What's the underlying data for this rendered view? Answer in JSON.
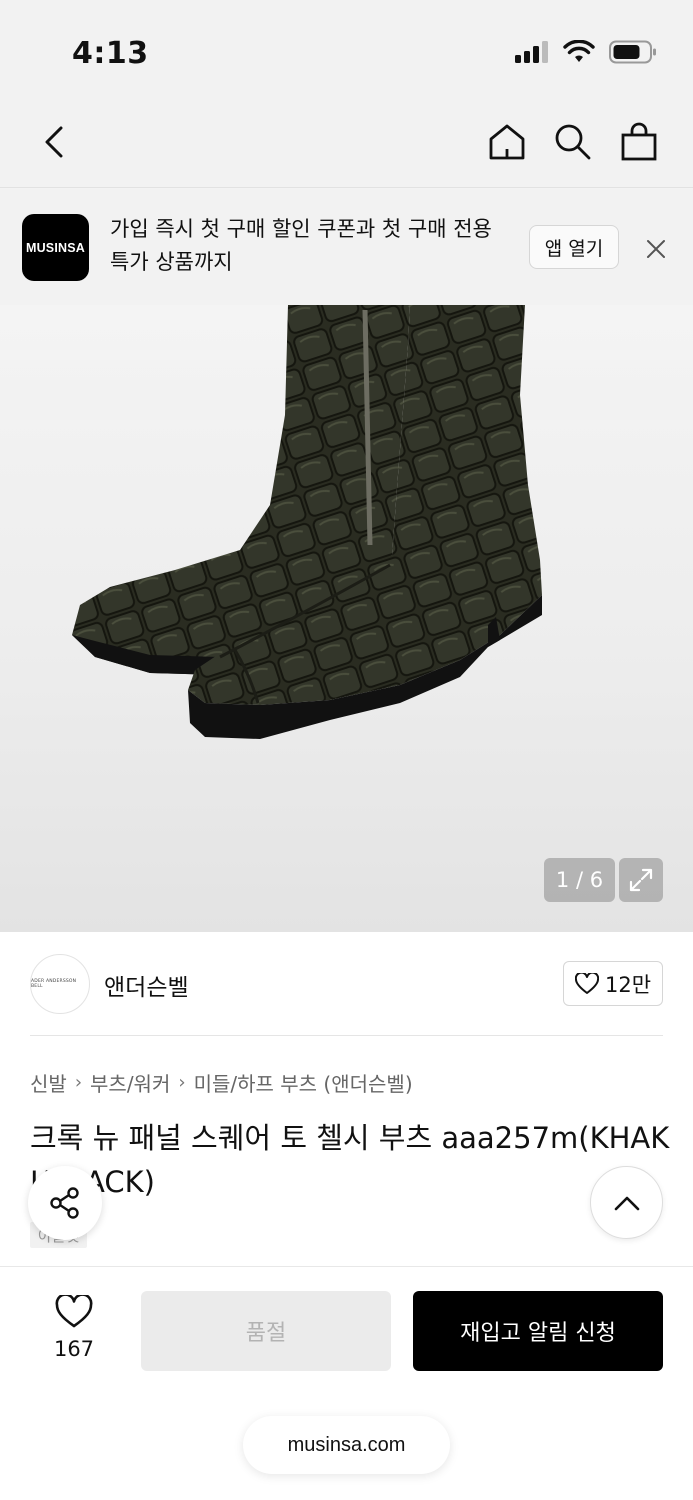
{
  "status_bar": {
    "time": "4:13"
  },
  "nav": {
    "icons": [
      "back-chevron-icon",
      "home-icon",
      "search-icon",
      "shopping-bag-icon"
    ]
  },
  "app_banner": {
    "logo_text": "MUSINSA",
    "message": "가입 즉시 첫 구매 할인 쿠폰과 첫 구매 전용 특가 상품까지",
    "open_app_label": "앱 열기"
  },
  "gallery": {
    "counter": "1 / 6"
  },
  "brand": {
    "logo_text": "ADER ANDERSSON BELL",
    "name": "앤더슨벨",
    "likes": "12만"
  },
  "breadcrumb": [
    "신발",
    "부츠/워커",
    "미들/하프 부츠 (앤더슨벨)"
  ],
  "product": {
    "title": "크록 뉴 패널 스퀘어 토 첼시 부츠 aaa257m(KHAKI/BLACK)",
    "tag": "아울렛"
  },
  "bottom_bar": {
    "wish_count": "167",
    "soldout_label": "품절",
    "restock_label": "재입고 알림 신청"
  },
  "browser": {
    "url": "musinsa.com"
  },
  "colors": {
    "primary": "#000000",
    "background": "#f2f2f2",
    "disabled": "#ebebeb"
  }
}
